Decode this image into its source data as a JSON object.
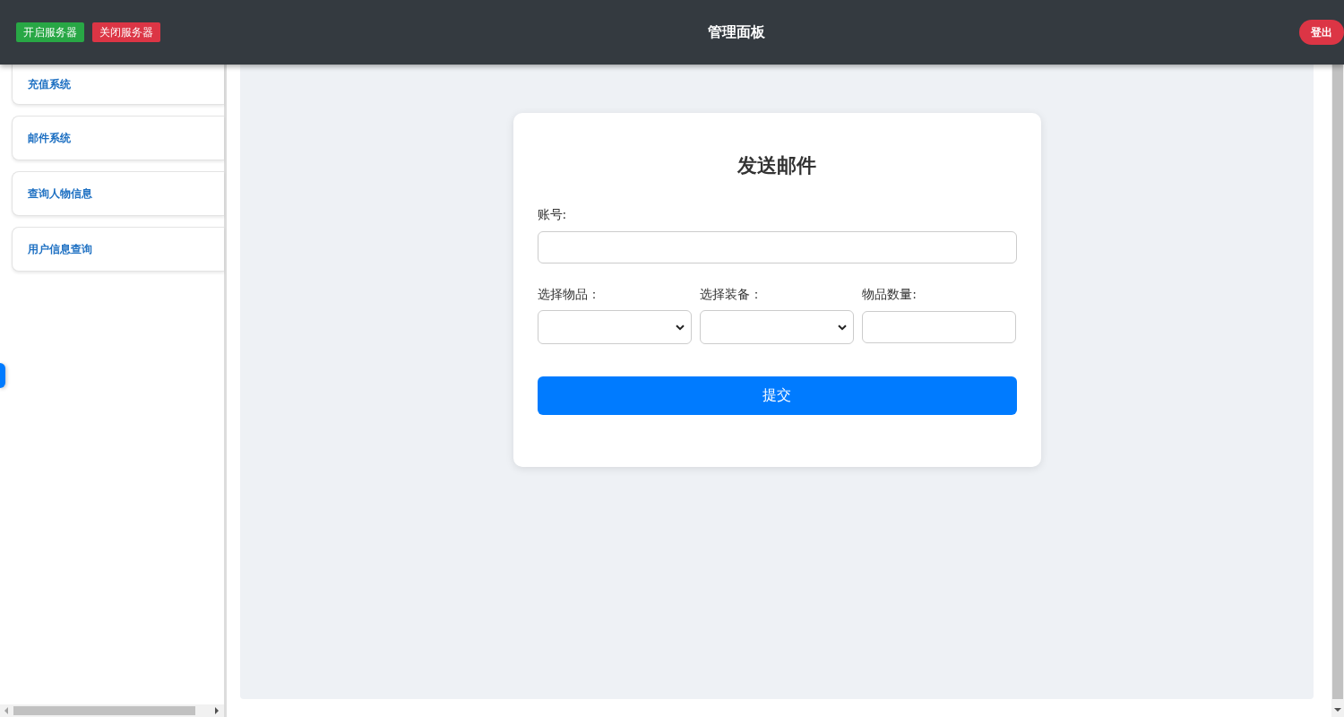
{
  "header": {
    "buttons": [
      {
        "label": "开启服务器",
        "kind": "success"
      },
      {
        "label": "关闭服务器",
        "kind": "danger"
      }
    ],
    "title": "管理面板",
    "logout": "登出"
  },
  "sidebar": {
    "items": [
      {
        "label": "充值系统"
      },
      {
        "label": "邮件系统"
      },
      {
        "label": "查询人物信息"
      },
      {
        "label": "用户信息查询"
      }
    ]
  },
  "form": {
    "title": "发送邮件",
    "rows": [
      {
        "fields": [
          {
            "kind": "text",
            "label": "账号:"
          }
        ]
      },
      {
        "fields": [
          {
            "kind": "select",
            "label": "选择物品："
          },
          {
            "kind": "select",
            "label": "选择装备："
          },
          {
            "kind": "text",
            "label": "物品数量:"
          }
        ]
      }
    ],
    "submit": "提交"
  }
}
